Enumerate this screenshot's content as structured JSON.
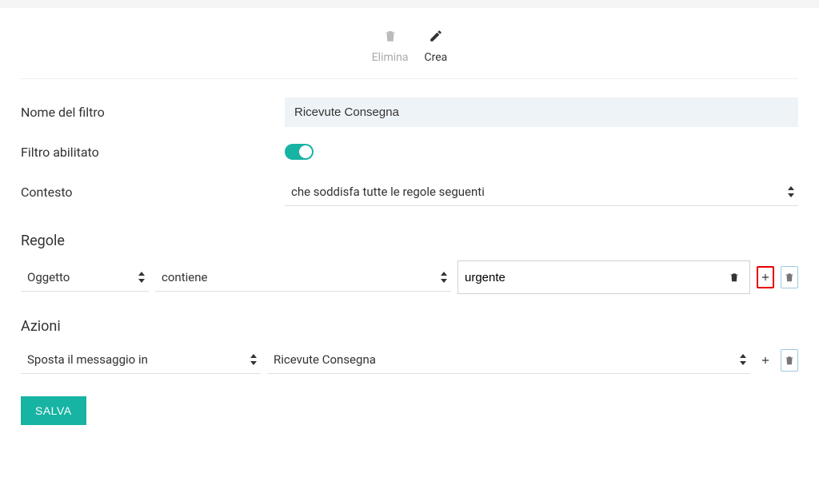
{
  "tabs": {
    "delete": "Elimina",
    "create": "Crea"
  },
  "form": {
    "filter_name_label": "Nome del filtro",
    "filter_name_value": "Ricevute Consegna",
    "enabled_label": "Filtro abilitato",
    "context_label": "Contesto",
    "context_value": "che soddisfa tutte le regole seguenti"
  },
  "rules": {
    "title": "Regole",
    "row": {
      "field": "Oggetto",
      "operator": "contiene",
      "value": "urgente"
    }
  },
  "actions": {
    "title": "Azioni",
    "row": {
      "action": "Sposta il messaggio in",
      "target": "Ricevute Consegna"
    }
  },
  "buttons": {
    "save": "SALVA"
  }
}
